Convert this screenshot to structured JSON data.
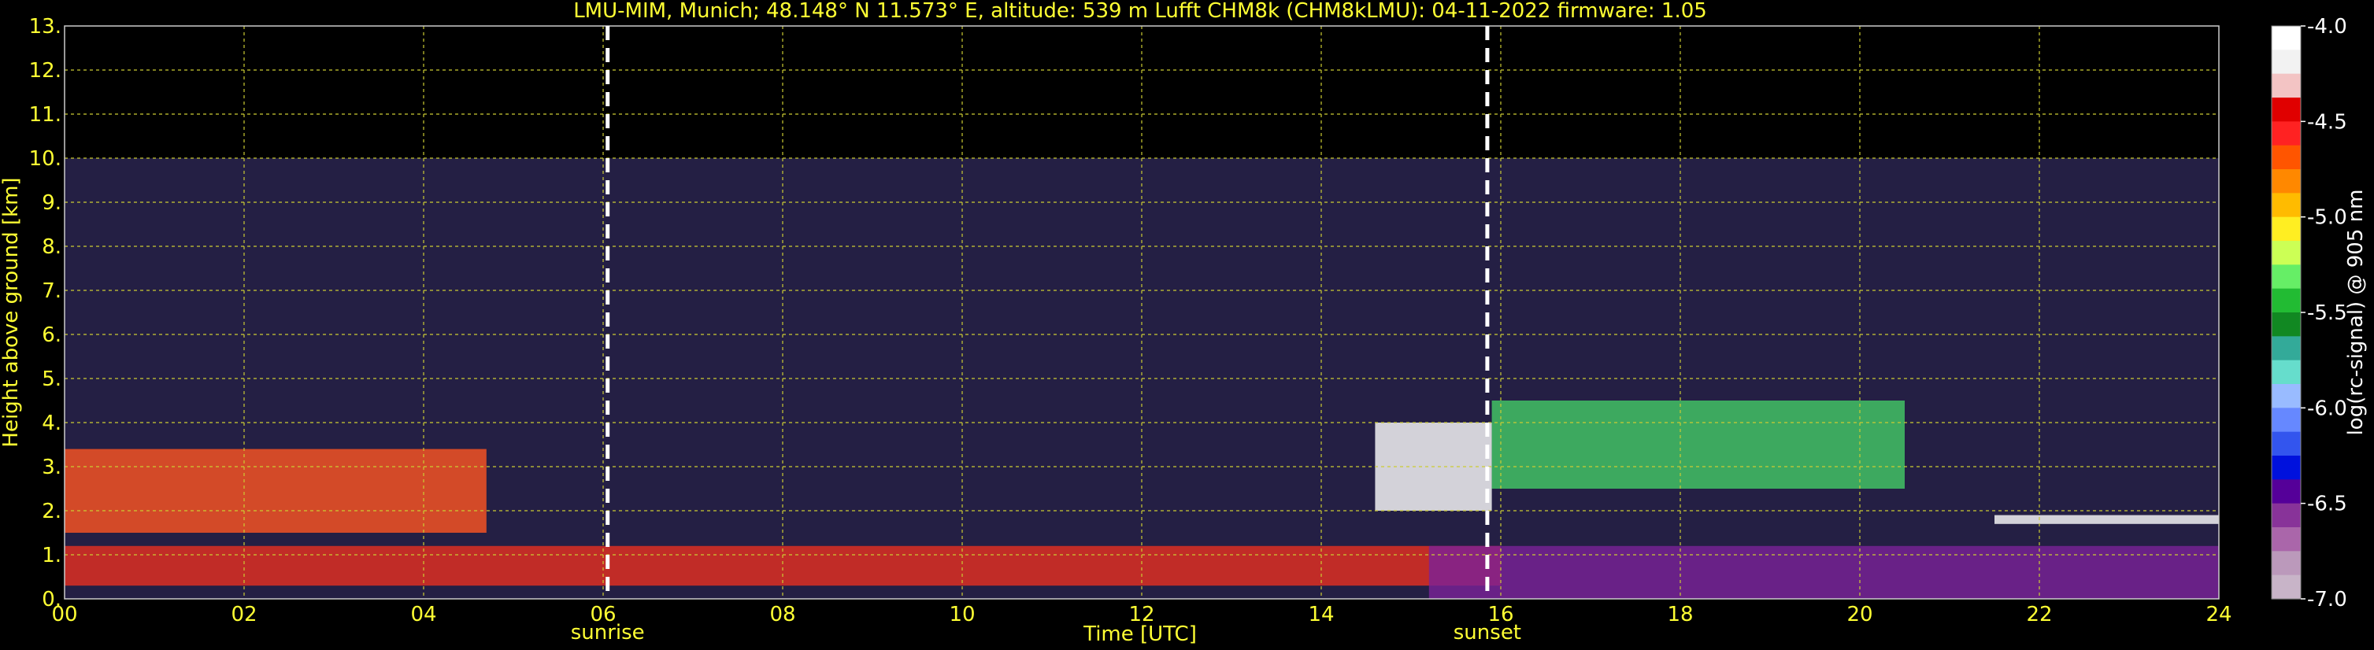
{
  "chart_data": {
    "type": "heatmap",
    "title": "LMU-MIM, Munich; 48.148° N 11.573° E, altitude: 539 m    Lufft CHM8k (CHM8kLMU): 04-11-2022    firmware: 1.05",
    "xlabel": "Time [UTC]",
    "ylabel": "Height above ground [km]",
    "xlim": [
      0,
      24
    ],
    "ylim": [
      0,
      13
    ],
    "xticks": [
      "00",
      "02",
      "04",
      "06",
      "08",
      "10",
      "12",
      "14",
      "16",
      "18",
      "20",
      "22",
      "24"
    ],
    "yticks": [
      "0.",
      "1.",
      "2.",
      "3.",
      "4.",
      "5.",
      "6.",
      "7.",
      "8.",
      "9.",
      "10.",
      "11.",
      "12.",
      "13."
    ],
    "grid": true,
    "markers": [
      {
        "label": "sunrise",
        "x": 6.05
      },
      {
        "label": "sunset",
        "x": 15.85
      }
    ],
    "colorbar": {
      "label": "log(rc-signal) @ 905 nm",
      "min": -7.0,
      "max": -4.0,
      "ticks": [
        "-4.0",
        "-4.5",
        "-5.0",
        "-5.5",
        "-6.0",
        "-6.5",
        "-7.0"
      ],
      "colors": [
        "#ffffff",
        "#f2f2f2",
        "#f3c4c4",
        "#e00000",
        "#ff2222",
        "#ff5500",
        "#ff8800",
        "#ffbb00",
        "#ffee22",
        "#ccff55",
        "#66ee66",
        "#22bb33",
        "#118822",
        "#33aa99",
        "#66ddcc",
        "#99bbff",
        "#6688ff",
        "#3355ee",
        "#0011dd",
        "#550099",
        "#883399",
        "#aa66aa",
        "#bb99bb",
        "#c8b4c8"
      ]
    },
    "features": [
      {
        "name": "noise-region",
        "x": [
          0,
          24
        ],
        "y": [
          0,
          10
        ]
      },
      {
        "name": "boundary-layer",
        "x": [
          0,
          16
        ],
        "y": [
          0.3,
          1.2
        ]
      },
      {
        "name": "cloud-layer-morning",
        "x": [
          0,
          4.7
        ],
        "y": [
          1.5,
          3.4
        ]
      },
      {
        "name": "cloud-afternoon",
        "x": [
          14.6,
          15.9
        ],
        "y": [
          2.0,
          4.0
        ]
      },
      {
        "name": "cloud-evening",
        "x": [
          15.9,
          20.5
        ],
        "y": [
          2.5,
          4.5
        ]
      },
      {
        "name": "cloud-night",
        "x": [
          21.5,
          24
        ],
        "y": [
          1.7,
          1.9
        ]
      },
      {
        "name": "purple-layer",
        "x": [
          15.2,
          24
        ],
        "y": [
          0,
          1.2
        ]
      }
    ]
  }
}
